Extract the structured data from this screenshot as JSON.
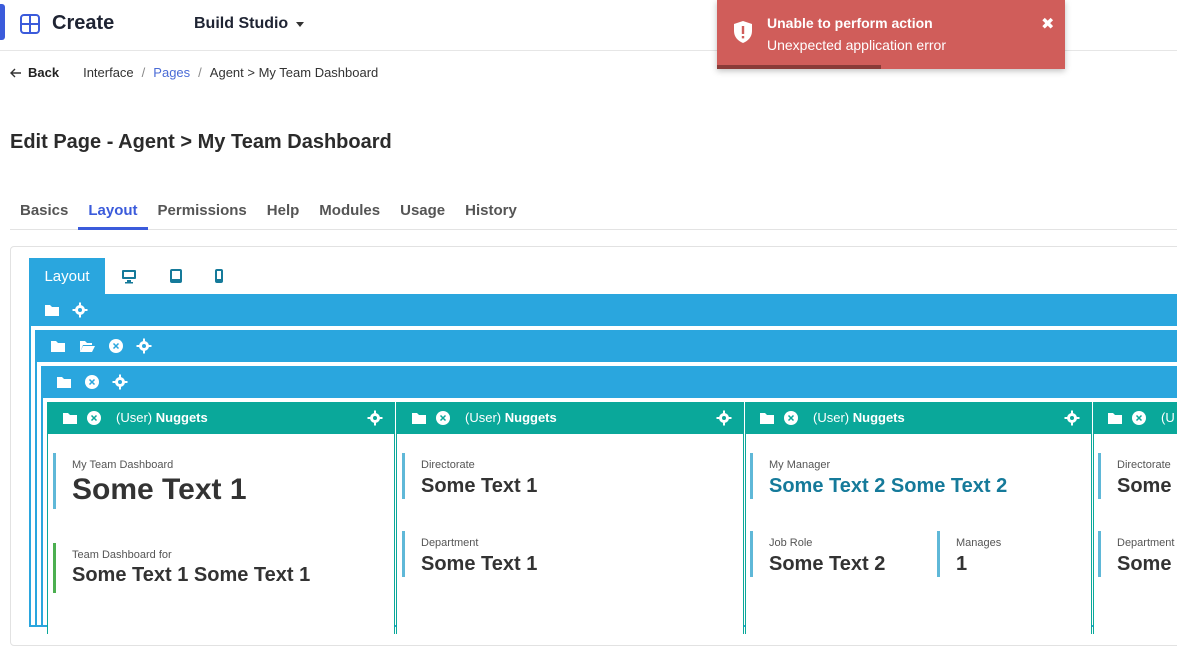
{
  "header": {
    "app_title": "Create",
    "studio_label": "Build Studio"
  },
  "breadcrumb": {
    "back": "Back",
    "items": [
      "Interface",
      "Pages",
      "Agent > My Team Dashboard"
    ]
  },
  "page_title": "Edit Page - Agent > My Team Dashboard",
  "tabs": [
    {
      "label": "Basics"
    },
    {
      "label": "Layout"
    },
    {
      "label": "Permissions"
    },
    {
      "label": "Help"
    },
    {
      "label": "Modules"
    },
    {
      "label": "Usage"
    },
    {
      "label": "History"
    }
  ],
  "active_tab": "Layout",
  "layout_tab": "Layout",
  "nuggets": [
    {
      "prefix": "(User)",
      "name": "Nuggets"
    },
    {
      "prefix": "(User)",
      "name": "Nuggets"
    },
    {
      "prefix": "(User)",
      "name": "Nuggets"
    },
    {
      "prefix": "(U"
    }
  ],
  "fields": {
    "c1a": {
      "label": "My Team Dashboard",
      "value": "Some Text 1"
    },
    "c1b": {
      "label": "Team Dashboard for",
      "value": "Some Text 1 Some Text 1"
    },
    "c2a": {
      "label": "Directorate",
      "value": "Some Text 1"
    },
    "c2b": {
      "label": "Department",
      "value": "Some Text 1"
    },
    "c3a": {
      "label": "My Manager",
      "value": "Some Text 2 Some Text 2"
    },
    "c3b": {
      "label": "Job Role",
      "value": "Some Text 2"
    },
    "c3c": {
      "label": "Manages",
      "value": "1"
    },
    "c4a": {
      "label": "Directorate",
      "value": "Some"
    },
    "c4b": {
      "label": "Department",
      "value": "Some"
    }
  },
  "toast": {
    "title": "Unable to perform action",
    "message": "Unexpected application error",
    "progress": 0.47
  },
  "colors": {
    "accent": "#3b5bdb",
    "container_blue": "#2aa6de",
    "nugget_teal": "#0aa89a",
    "error_red": "#d05d5a"
  }
}
